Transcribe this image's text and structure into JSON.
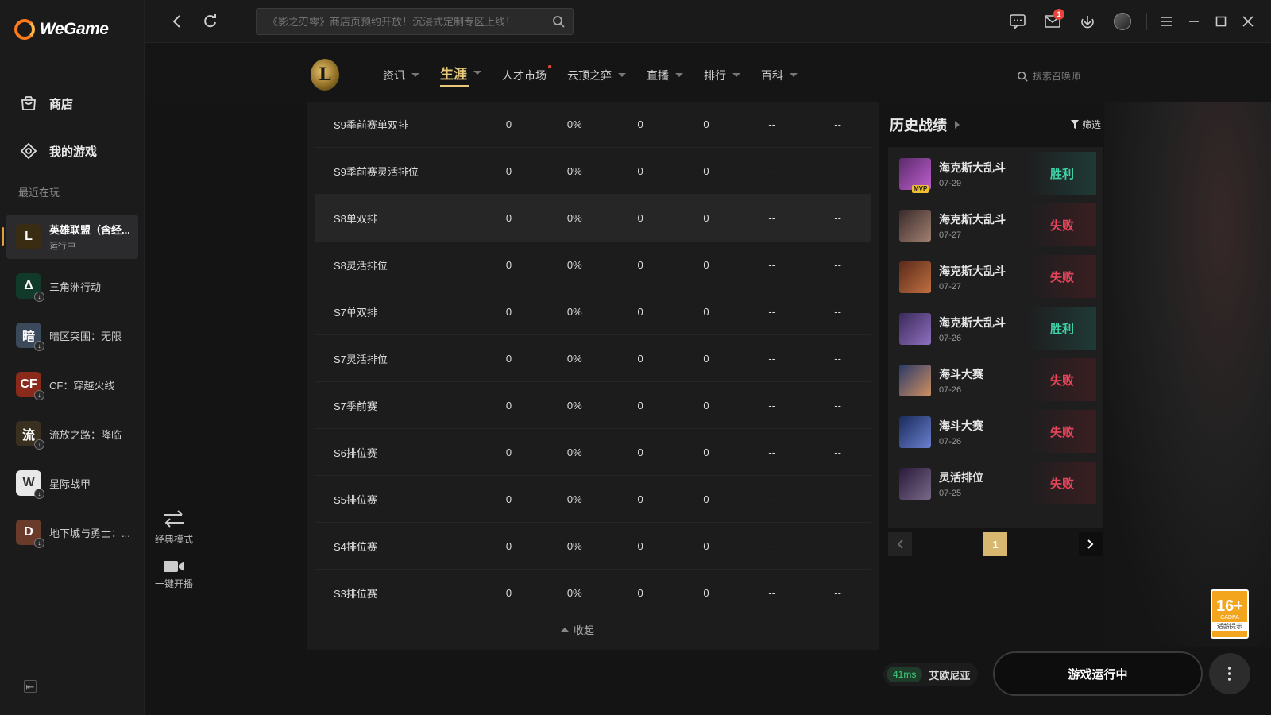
{
  "app": {
    "logo_text": "WeGame"
  },
  "sidebar": {
    "nav": [
      {
        "label": "商店",
        "icon": "bag-icon"
      },
      {
        "label": "我的游戏",
        "icon": "gamepad-icon"
      }
    ],
    "recent_title": "最近在玩",
    "games": [
      {
        "name": "英雄联盟（含经...",
        "status": "运行中",
        "color": "#3a2c12",
        "glyph": "L"
      },
      {
        "name": "三角洲行动",
        "status": "",
        "color": "#123a2a",
        "glyph": "Δ"
      },
      {
        "name": "暗区突围：无限",
        "status": "",
        "color": "#3a4a5a",
        "glyph": "暗"
      },
      {
        "name": "CF：穿越火线",
        "status": "",
        "color": "#8a2a1a",
        "glyph": "CF"
      },
      {
        "name": "流放之路：降临",
        "status": "",
        "color": "#3a3020",
        "glyph": "流"
      },
      {
        "name": "星际战甲",
        "status": "",
        "color": "#e8e8e8",
        "glyph": "W"
      },
      {
        "name": "地下城与勇士：...",
        "status": "",
        "color": "#6a3a2a",
        "glyph": "D"
      }
    ]
  },
  "topbar": {
    "search_placeholder": "《影之刃零》商店页预约开放！沉浸式定制专区上线！",
    "mail_badge": "1"
  },
  "gamenav": {
    "logo_glyph": "L",
    "tabs": [
      {
        "label": "资讯",
        "caret": true,
        "dot": false,
        "active": false
      },
      {
        "label": "生涯",
        "caret": true,
        "dot": false,
        "active": true
      },
      {
        "label": "人才市场",
        "caret": false,
        "dot": true,
        "active": false
      },
      {
        "label": "云顶之弈",
        "caret": true,
        "dot": false,
        "active": false
      },
      {
        "label": "直播",
        "caret": true,
        "dot": false,
        "active": false
      },
      {
        "label": "排行",
        "caret": true,
        "dot": false,
        "active": false
      },
      {
        "label": "百科",
        "caret": true,
        "dot": false,
        "active": false
      }
    ],
    "summoner_search": "搜索召唤师"
  },
  "table": {
    "rows": [
      [
        "S9季前赛单双排",
        "0",
        "0%",
        "0",
        "0",
        "--",
        "--"
      ],
      [
        "S9季前赛灵活排位",
        "0",
        "0%",
        "0",
        "0",
        "--",
        "--"
      ],
      [
        "S8单双排",
        "0",
        "0%",
        "0",
        "0",
        "--",
        "--"
      ],
      [
        "S8灵活排位",
        "0",
        "0%",
        "0",
        "0",
        "--",
        "--"
      ],
      [
        "S7单双排",
        "0",
        "0%",
        "0",
        "0",
        "--",
        "--"
      ],
      [
        "S7灵活排位",
        "0",
        "0%",
        "0",
        "0",
        "--",
        "--"
      ],
      [
        "S7季前赛",
        "0",
        "0%",
        "0",
        "0",
        "--",
        "--"
      ],
      [
        "S6排位赛",
        "0",
        "0%",
        "0",
        "0",
        "--",
        "--"
      ],
      [
        "S5排位赛",
        "0",
        "0%",
        "0",
        "0",
        "--",
        "--"
      ],
      [
        "S4排位赛",
        "0",
        "0%",
        "0",
        "0",
        "--",
        "--"
      ],
      [
        "S3排位赛",
        "0",
        "0%",
        "0",
        "0",
        "--",
        "--"
      ]
    ],
    "highlight_index": 2,
    "collapse_label": "收起"
  },
  "left_tools": {
    "mode_label": "经典模式",
    "stream_label": "一键开播"
  },
  "history": {
    "title": "历史战绩",
    "filter_label": "筛选",
    "matches": [
      {
        "mode": "海克斯大乱斗",
        "date": "07-29",
        "result": "胜利",
        "win": true,
        "mvp": "MVP",
        "colors": [
          "#5a2a6a",
          "#c060d0"
        ]
      },
      {
        "mode": "海克斯大乱斗",
        "date": "07-27",
        "result": "失败",
        "win": false,
        "mvp": "",
        "colors": [
          "#3a2a2a",
          "#a08070"
        ]
      },
      {
        "mode": "海克斯大乱斗",
        "date": "07-27",
        "result": "失败",
        "win": false,
        "mvp": "",
        "colors": [
          "#5a2a1a",
          "#c07040"
        ]
      },
      {
        "mode": "海克斯大乱斗",
        "date": "07-26",
        "result": "胜利",
        "win": true,
        "mvp": "",
        "colors": [
          "#3a2a5a",
          "#9070c0"
        ]
      },
      {
        "mode": "海斗大赛",
        "date": "07-26",
        "result": "失败",
        "win": false,
        "mvp": "",
        "colors": [
          "#2a3a6a",
          "#d09060"
        ]
      },
      {
        "mode": "海斗大赛",
        "date": "07-26",
        "result": "失败",
        "win": false,
        "mvp": "",
        "colors": [
          "#1a2a5a",
          "#6a80d0"
        ]
      },
      {
        "mode": "灵活排位",
        "date": "07-25",
        "result": "失败",
        "win": false,
        "mvp": "",
        "colors": [
          "#2a1a3a",
          "#7a6a8a"
        ]
      }
    ],
    "page": "1"
  },
  "bottom": {
    "ping": "41ms",
    "server": "艾欧尼亚",
    "play_label": "游戏运行中",
    "age_rating": "16+",
    "age_sub": "CADPA",
    "age_tip": "适龄提示"
  }
}
